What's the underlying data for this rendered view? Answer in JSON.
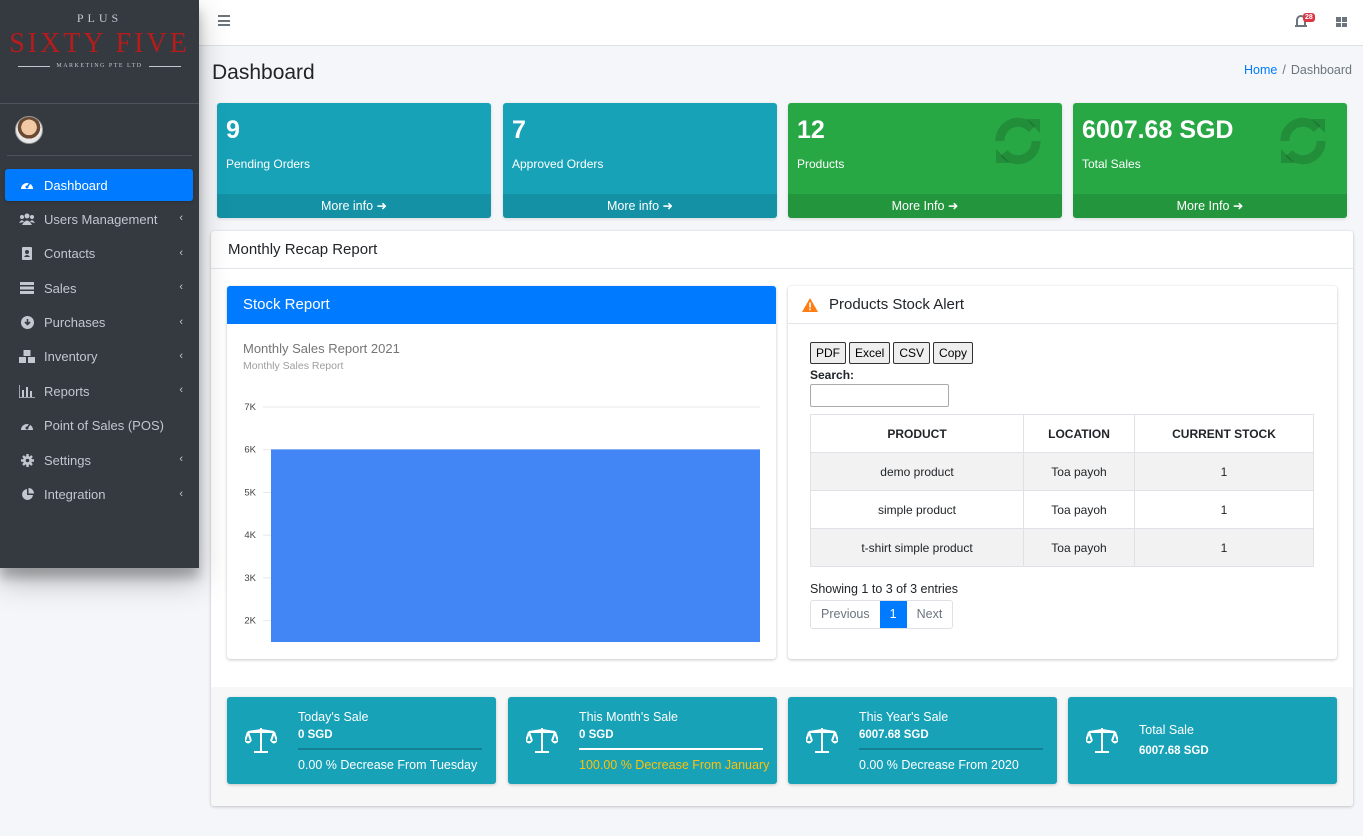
{
  "brand": {
    "top": "PLUS",
    "main": "SIXTY FIVE",
    "sub": "MARKETING PTE LTD"
  },
  "sidebar": {
    "items": [
      {
        "label": "Dashboard",
        "icon": "tachometer-icon",
        "active": true,
        "chevron": false
      },
      {
        "label": "Users Management",
        "icon": "users-icon",
        "chevron": true
      },
      {
        "label": "Contacts",
        "icon": "address-book-icon",
        "chevron": true
      },
      {
        "label": "Sales",
        "icon": "list-icon",
        "chevron": true
      },
      {
        "label": "Purchases",
        "icon": "download-circle-icon",
        "chevron": true
      },
      {
        "label": "Inventory",
        "icon": "cubes-icon",
        "chevron": true
      },
      {
        "label": "Reports",
        "icon": "bar-chart-icon",
        "chevron": true
      },
      {
        "label": "Point of Sales (POS)",
        "icon": "tachometer-icon",
        "chevron": false
      },
      {
        "label": "Settings",
        "icon": "gear-icon",
        "chevron": true
      },
      {
        "label": "Integration",
        "icon": "pie-chart-icon",
        "chevron": true
      }
    ]
  },
  "topbar": {
    "notification_count": "28"
  },
  "header": {
    "title": "Dashboard",
    "breadcrumb_home": "Home",
    "breadcrumb_current": "Dashboard"
  },
  "stats": [
    {
      "value": "9",
      "label": "Pending Orders",
      "link": "More info",
      "color": "#17a2b8"
    },
    {
      "value": "7",
      "label": "Approved Orders",
      "link": "More info",
      "color": "#17a2b8"
    },
    {
      "value": "12",
      "label": "Products",
      "link": "More Info",
      "color": "#28a745"
    },
    {
      "value": "6007.68 SGD",
      "label": "Total Sales",
      "link": "More Info",
      "color": "#28a745"
    }
  ],
  "recap": {
    "title": "Monthly Recap Report",
    "stock_report_title": "Stock Report",
    "chart_title": "Monthly Sales Report 2021",
    "chart_subtitle": "Monthly Sales Report"
  },
  "chart_data": {
    "type": "bar",
    "title": "Monthly Sales Report 2021",
    "subtitle": "Monthly Sales Report",
    "categories": [
      ""
    ],
    "values": [
      6007.68
    ],
    "ylim": [
      1500,
      7000
    ],
    "yticks": [
      "2K",
      "3K",
      "4K",
      "5K",
      "6K",
      "7K"
    ],
    "color": "#4285f4",
    "grid": true
  },
  "stock_alert": {
    "title": "Products Stock Alert",
    "buttons": [
      "PDF",
      "Excel",
      "CSV",
      "Copy"
    ],
    "search_label": "Search:",
    "columns": [
      "PRODUCT",
      "LOCATION",
      "CURRENT STOCK"
    ],
    "rows": [
      [
        "demo product",
        "Toa payoh",
        "1"
      ],
      [
        "simple product",
        "Toa payoh",
        "1"
      ],
      [
        "t-shirt simple product",
        "Toa payoh",
        "1"
      ]
    ],
    "showing": "Showing 1 to 3 of 3 entries",
    "prev": "Previous",
    "page": "1",
    "next": "Next"
  },
  "sales_boxes": [
    {
      "title": "Today's Sale",
      "value": "0 SGD",
      "desc": "0.00 % Decrease From Tuesday",
      "progress": 0
    },
    {
      "title": "This Month's Sale",
      "value": "0 SGD",
      "desc": "100.00 % Decrease From January",
      "progress": 1,
      "desc_color": "#ffc107"
    },
    {
      "title": "This Year's Sale",
      "value": "6007.68 SGD",
      "desc": "0.00 % Decrease From 2020",
      "progress": 0
    },
    {
      "title": "Total Sale",
      "value": "6007.68 SGD"
    }
  ]
}
